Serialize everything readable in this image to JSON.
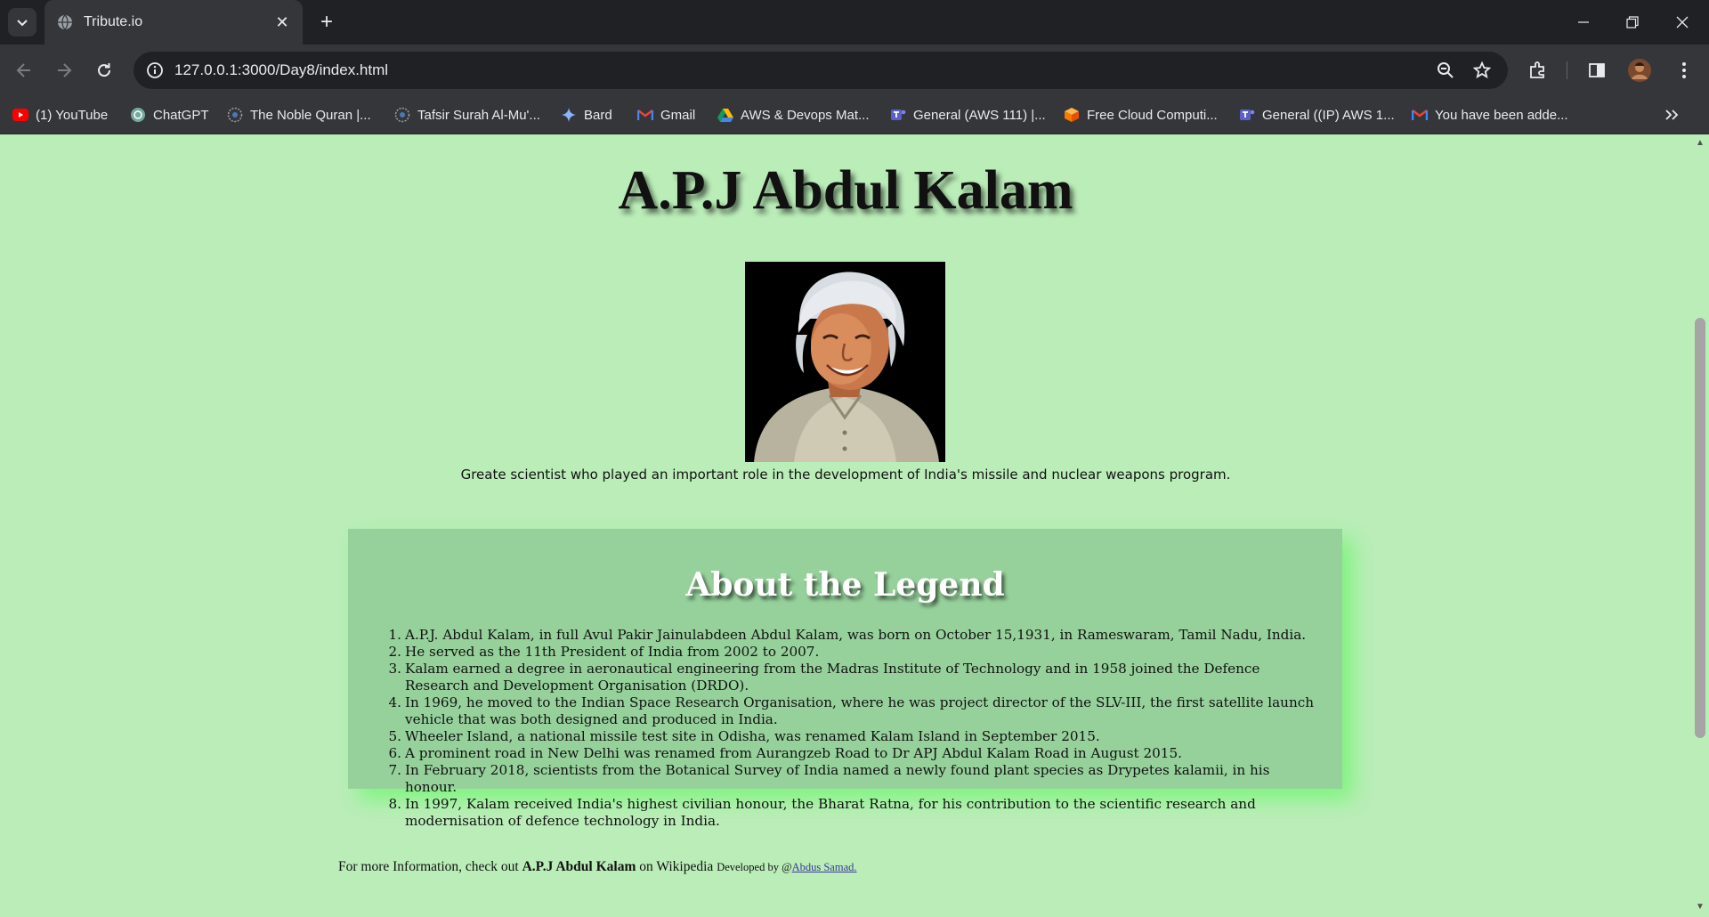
{
  "browser": {
    "tab_title": "Tribute.io",
    "url": "127.0.0.1:3000/Day8/index.html",
    "bookmarks": [
      {
        "label": "(1) YouTube",
        "icon": "youtube-icon"
      },
      {
        "label": "ChatGPT",
        "icon": "chatgpt-icon"
      },
      {
        "label": "The Noble Quran |...",
        "icon": "quran-icon"
      },
      {
        "label": "Tafsir Surah Al-Mu'...",
        "icon": "quran-icon"
      },
      {
        "label": "Bard",
        "icon": "bard-icon"
      },
      {
        "label": "Gmail",
        "icon": "gmail-icon"
      },
      {
        "label": "AWS & Devops Mat...",
        "icon": "drive-icon"
      },
      {
        "label": "General (AWS 111) |...",
        "icon": "teams-icon"
      },
      {
        "label": "Free Cloud Computi...",
        "icon": "cube-icon"
      },
      {
        "label": "General ((IP) AWS 1...",
        "icon": "teams-icon"
      },
      {
        "label": "You have been adde...",
        "icon": "gmail-icon"
      }
    ]
  },
  "page": {
    "title": "A.P.J Abdul Kalam",
    "caption": "Greate scientist who played an important role in the development of India's missile and nuclear weapons program.",
    "about_heading": "About the Legend",
    "facts": [
      "A.P.J. Abdul Kalam, in full Avul Pakir Jainulabdeen Abdul Kalam, was born on October 15,1931, in Rameswaram, Tamil Nadu, India.",
      "He served as the 11th President of India from 2002 to 2007.",
      "Kalam earned a degree in aeronautical engineering from the Madras Institute of Technology and in 1958 joined the Defence Research and Development Organisation (DRDO).",
      "In 1969, he moved to the Indian Space Research Organisation, where he was project director of the SLV-III, the first satellite launch vehicle that was both designed and produced in India.",
      "Wheeler Island, a national missile test site in Odisha, was renamed Kalam Island in September 2015.",
      "A prominent road in New Delhi was renamed from Aurangzeb Road to Dr APJ Abdul Kalam Road in August 2015.",
      "In February 2018, scientists from the Botanical Survey of India named a newly found plant species as Drypetes kalamii, in his honour.",
      "In 1997, Kalam received India's highest civilian honour, the Bharat Ratna, for his contribution to the scientific research and modernisation of defence technology in India."
    ],
    "footer": {
      "prefix": "For more Information, check out",
      "name": "A.P.J Abdul Kalam",
      "suffix": "on Wikipedia",
      "dev_prefix": "Developed by @",
      "dev_link": "Abdus Samad."
    }
  },
  "colors": {
    "page_background": "#bbedb9",
    "about_background": "#96d19b",
    "about_glow": "#78f578"
  }
}
